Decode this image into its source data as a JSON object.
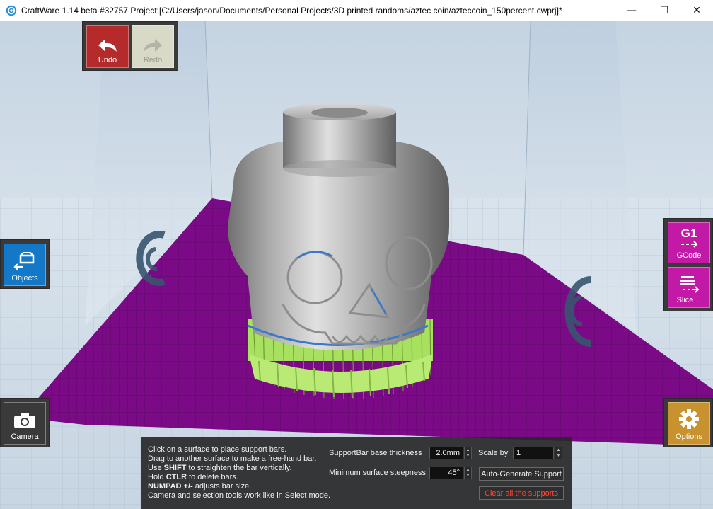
{
  "window": {
    "title": "CraftWare 1.14 beta #32757  Project:[C:/Users/jason/Documents/Personal Projects/3D printed randoms/aztec coin/azteccoin_150percent.cwprj]*",
    "minimize": "—",
    "maximize": "☐",
    "close": "✕"
  },
  "toolbar": {
    "undo_label": "Undo",
    "redo_label": "Redo",
    "objects_label": "Objects",
    "camera_label": "Camera",
    "gcode_label": "GCode",
    "gcode_badge": "G1",
    "slice_label": "Slice…",
    "options_label": "Options"
  },
  "support_panel": {
    "help": {
      "line1": "Click on a surface to place support bars.",
      "line2": "Drag to another surface to make a free-hand bar.",
      "line3_pre": "Use ",
      "line3_key": "SHIFT",
      "line3_post": " to straighten the bar vertically.",
      "line4_pre": "Hold ",
      "line4_key": "CTLR",
      "line4_post": " to delete bars.",
      "line5_key": "NUMPAD +/-",
      "line5_post": " adjusts bar size.",
      "line6": "Camera and selection tools work like in Select mode."
    },
    "base_thickness_label": "SupportBar base thickness",
    "base_thickness_value": "2.0mm",
    "scale_label": "Scale by",
    "scale_value": "1",
    "steepness_label": "Minimum surface steepness:",
    "steepness_value": "45°",
    "auto_generate_label": "Auto-Generate Support",
    "clear_label": "Clear all the supports"
  },
  "colors": {
    "undo": "#b52a2a",
    "redo": "#d9d9c8",
    "objects": "#1478c8",
    "camera": "#3a3a3a",
    "gcode": "#c21aa6",
    "options": "#c8922e",
    "bed": "#7a0a86",
    "support": "#a8e060",
    "clear_text": "#ff4a3a"
  }
}
